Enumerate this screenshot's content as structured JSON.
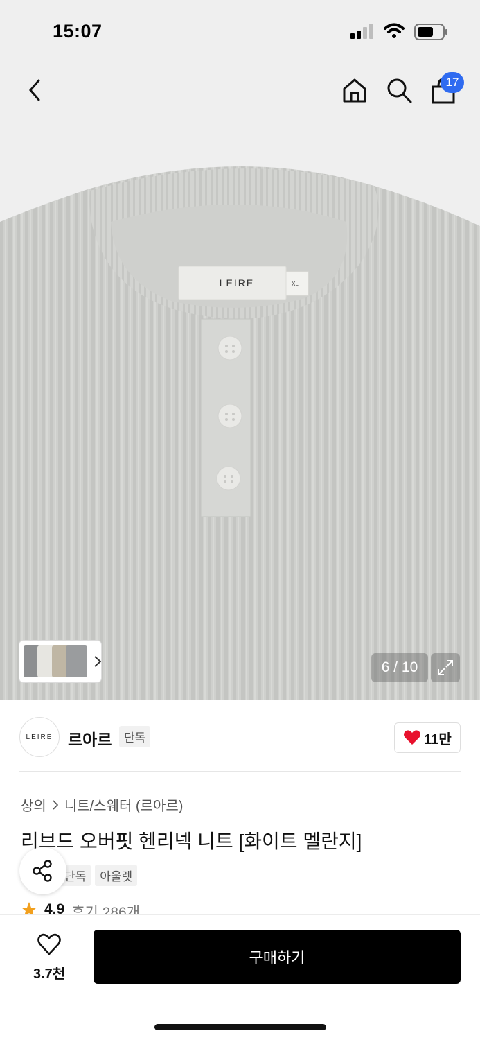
{
  "status_bar": {
    "time": "15:07"
  },
  "header": {
    "cart_count": "17"
  },
  "gallery": {
    "label_text": "LEIRE",
    "size_label": "XL",
    "pager": "6 / 10"
  },
  "brand": {
    "logo_text": "LEIRE",
    "name": "르아르",
    "badge": "단독",
    "like_count": "11만"
  },
  "product": {
    "breadcrumb": [
      "상의",
      "니트/스웨터 (르아르)"
    ],
    "title": "리브드 오버핏 헨리넥 니트 [화이트 멜란지]",
    "tags": [
      "단독",
      "아울렛"
    ],
    "rating": "4.9",
    "review_text": "후기 286개"
  },
  "bottom_bar": {
    "wish_count": "3.7천",
    "buy_label": "구매하기"
  },
  "colors": {
    "accent_blue": "#2f6bf0",
    "heart_red": "#e8112d",
    "star_orange": "#f2a01e",
    "sweater_gray": "#cfd0cd"
  }
}
